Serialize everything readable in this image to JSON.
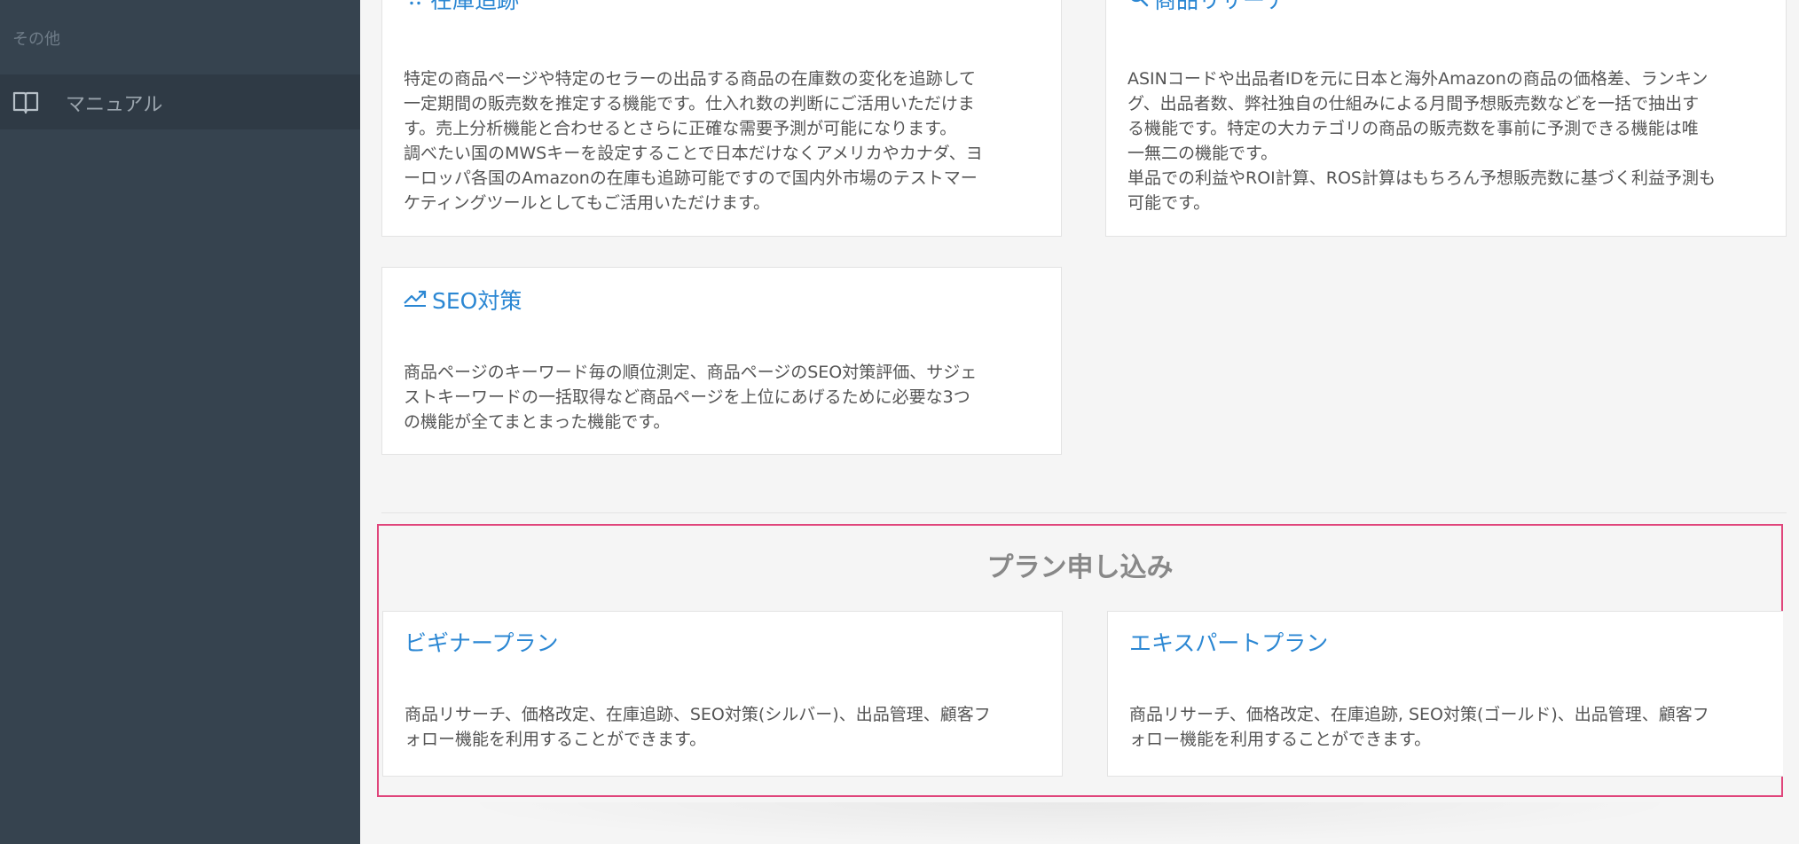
{
  "sidebar": {
    "section_label": "その他",
    "items": [
      {
        "label": "マニュアル",
        "icon": "book-icon"
      }
    ]
  },
  "features": {
    "inventory": {
      "title": "在庫追跡",
      "icon": "cart-icon",
      "desc": "特定の商品ページや特定のセラーの出品する商品の在庫数の変化を追跡して\n一定期間の販売数を推定する機能です。仕入れ数の判断にご活用いただけま\nす。売上分析機能と合わせるとさらに正確な需要予測が可能になります。\n調べたい国のMWSキーを設定することで日本だけなくアメリカやカナダ、ヨ\nーロッパ各国のAmazonの在庫も追跡可能ですので国内外市場のテストマー\nケティングツールとしてもご活用いただけます。"
    },
    "research": {
      "title": "商品リサーチ",
      "icon": "search-icon",
      "desc": "ASINコードや出品者IDを元に日本と海外Amazonの商品の価格差、ランキン\nグ、出品者数、弊社独自の仕組みによる月間予想販売数などを一括で抽出す\nる機能です。特定の大カテゴリの商品の販売数を事前に予測できる機能は唯\n一無二の機能です。\n単品での利益やROI計算、ROS計算はもちろん予想販売数に基づく利益予測も\n可能です。"
    },
    "seo": {
      "title": "SEO対策",
      "icon": "trending-up-icon",
      "desc": "商品ページのキーワード毎の順位測定、商品ページのSEO対策評価、サジェ\nストキーワードの一括取得など商品ページを上位にあげるために必要な3つ\nの機能が全てまとまった機能です。"
    }
  },
  "plans": {
    "heading": "プラン申し込み",
    "beginner": {
      "title": "ビギナープラン",
      "desc": "商品リサーチ、価格改定、在庫追跡、SEO対策(シルバー)、出品管理、顧客フ\nォロー機能を利用することができます。"
    },
    "expert": {
      "title": "エキスパートプラン",
      "desc": "商品リサーチ、価格改定、在庫追跡, SEO対策(ゴールド)、出品管理、顧客フ\nォロー機能を利用することができます。"
    }
  },
  "colors": {
    "sidebar_bg": "#36434f",
    "link_blue": "#2b87d3",
    "highlight_border": "#e0457b"
  }
}
